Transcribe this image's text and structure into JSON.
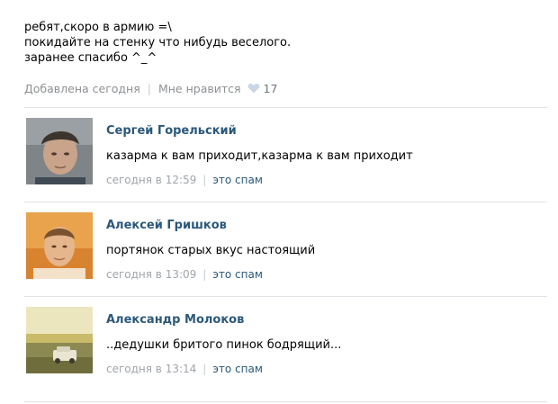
{
  "post": {
    "text": "ребят,скоро в армию =\\\nпокидайте на стенку что нибудь веселого.\nзаранее спасибо ^_^",
    "added": "Добавлена сегодня",
    "like_label": "Мне нравится",
    "like_count": "17"
  },
  "comments": [
    {
      "author": "Сергей Горельский",
      "text": "казарма к вам приходит,казарма к вам приходит",
      "time": "сегодня в 12:59",
      "spam": "это спам",
      "avatar_colors": [
        "#8a8f92",
        "#c7a58d",
        "#3d3a35"
      ]
    },
    {
      "author": "Алексей Гришков",
      "text": "портянок старых вкус настоящий",
      "time": "сегодня в 13:09",
      "spam": "это спам",
      "avatar_colors": [
        "#e29a3c",
        "#e8b78e",
        "#6b4a2e"
      ]
    },
    {
      "author": "Александр Молоков",
      "text": "..дедушки бритого пинок бодрящий...",
      "time": "сегодня в 13:14",
      "spam": "это спам",
      "avatar_colors": [
        "#c9bb6a",
        "#8c8a52",
        "#e9e5d2"
      ]
    }
  ],
  "colors": {
    "link": "#2b587a",
    "meta": "#8d9093",
    "divider": "#dfe3e7",
    "heart": "#c9d6e4"
  }
}
